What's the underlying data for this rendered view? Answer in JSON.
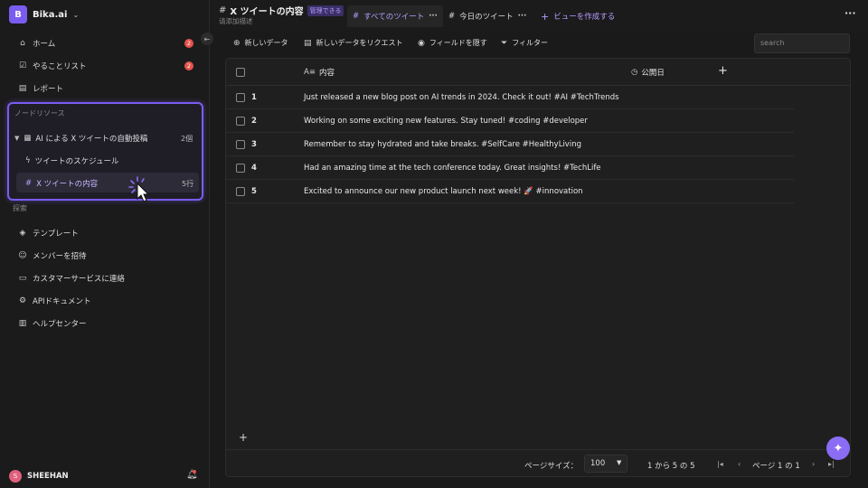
{
  "workspace": {
    "avatar": "B",
    "name": "Bika.ai"
  },
  "sidebar": {
    "nav": [
      {
        "label": "ホーム",
        "icon": "home-icon",
        "badge": "2"
      },
      {
        "label": "やることリスト",
        "icon": "checkbox-icon",
        "badge": "2"
      },
      {
        "label": "レポート",
        "icon": "report-icon",
        "badge": ""
      }
    ],
    "node_section_label": "ノードリソース",
    "folder": {
      "label": "AI による X ツイートの自動投稿",
      "count": "2個"
    },
    "children": [
      {
        "label": "ツイートのスケジュール",
        "icon": "automation-icon",
        "count": ""
      },
      {
        "label": "X ツイートの内容",
        "icon": "table-icon",
        "count": "5行"
      }
    ],
    "explore_label": "探索",
    "explore": [
      {
        "label": "テンプレート",
        "icon": "template-icon"
      },
      {
        "label": "メンバーを招待",
        "icon": "invite-member-icon"
      },
      {
        "label": "カスタマーサービスに連絡",
        "icon": "support-icon"
      },
      {
        "label": "APIドキュメント",
        "icon": "api-docs-icon"
      },
      {
        "label": "ヘルプセンター",
        "icon": "help-book-icon"
      }
    ],
    "user": {
      "avatar": "S",
      "name": "SHEEHAN"
    }
  },
  "header": {
    "title": "X ツイートの内容",
    "tag": "管理できる",
    "subtitle": "请添加描述",
    "tabs": [
      {
        "label": "すべてのツイート",
        "active": true
      },
      {
        "label": "今日のツイート",
        "active": false
      }
    ],
    "create_view": "ビューを作成する"
  },
  "toolbar": {
    "new_record": "新しいデータ",
    "request_record": "新しいデータをリクエスト",
    "hide_fields": "フィールドを隠す",
    "filter": "フィルター",
    "search_placeholder": "search"
  },
  "table": {
    "columns": [
      "内容",
      "公開日"
    ],
    "rows": [
      {
        "num": "1",
        "content": "Just released a new blog post on AI trends in 2024. Check it out! #AI #TechTrends"
      },
      {
        "num": "2",
        "content": "Working on some exciting new features. Stay tuned! #coding #developer"
      },
      {
        "num": "3",
        "content": "Remember to stay hydrated and take breaks. #SelfCare #HealthyLiving"
      },
      {
        "num": "4",
        "content": "Had an amazing time at the tech conference today. Great insights! #TechLife"
      },
      {
        "num": "5",
        "content": "Excited to announce our new product launch next week! 🚀 #innovation"
      }
    ]
  },
  "pager": {
    "page_size_label": "ページサイズ：",
    "page_size": "100",
    "range": "1 から 5 の 5",
    "page": "ページ 1 の 1"
  },
  "colors": {
    "accent": "#7b5cf0",
    "badge": "#e5534b"
  }
}
